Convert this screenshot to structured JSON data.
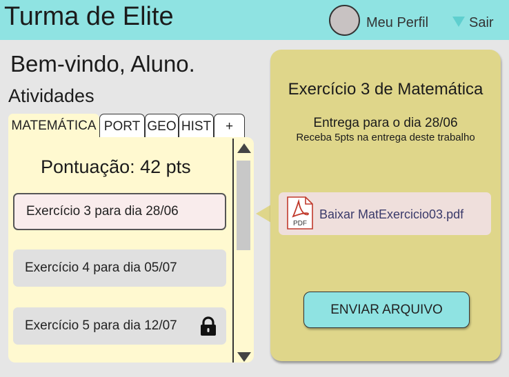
{
  "header": {
    "title": "Turma de Elite",
    "profile_label": "Meu Perfil",
    "logout_label": "Sair",
    "accent_color": "#8fe3e2"
  },
  "main": {
    "welcome": "Bem-vindo, Aluno.",
    "section_title": "Atividades",
    "tabs": [
      {
        "label": "MATEMÁTICA",
        "active": true
      },
      {
        "label": "PORT",
        "active": false
      },
      {
        "label": "GEO",
        "active": false
      },
      {
        "label": "HIST",
        "active": false
      },
      {
        "label": "+",
        "active": false
      }
    ],
    "score": "Pontuação: 42 pts",
    "tasks": [
      {
        "label": "Exercício 3 para dia 28/06",
        "selected": true,
        "locked": false
      },
      {
        "label": "Exercício 4 para dia 05/07",
        "selected": false,
        "locked": false
      },
      {
        "label": "Exercício 5 para dia 12/07",
        "selected": false,
        "locked": true
      }
    ]
  },
  "detail": {
    "title": "Exercício 3 de Matemática",
    "due": "Entrega para o dia 28/06",
    "reward": "Receba 5pts na entrega deste trabalho",
    "file_icon": "pdf-icon",
    "file_icon_text": "PDF",
    "download_label": "Baixar MatExercicio03.pdf",
    "send_button": "ENVIAR ARQUIVO"
  }
}
